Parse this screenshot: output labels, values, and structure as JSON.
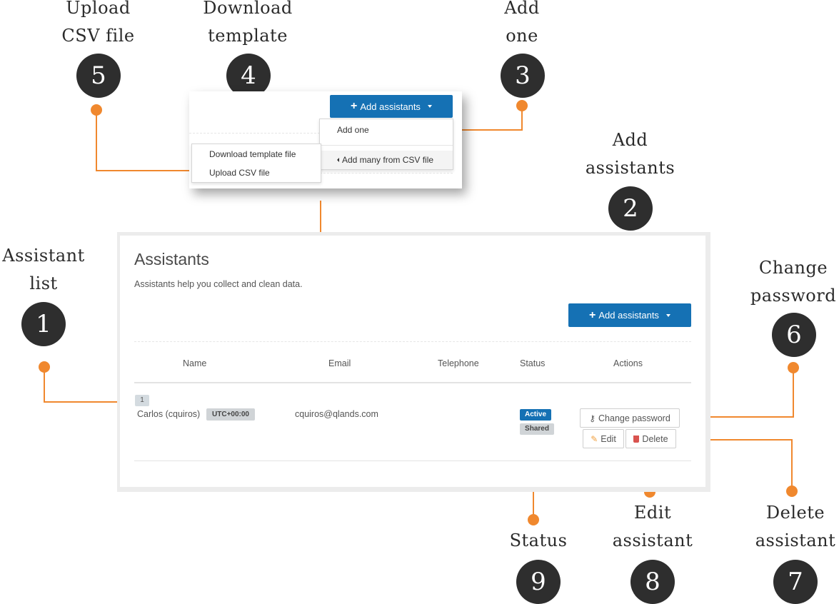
{
  "annotations": {
    "a1": {
      "line1": "Assistant",
      "line2": "list",
      "num": "1"
    },
    "a2": {
      "line1": "Add",
      "line2": "assistants",
      "num": "2"
    },
    "a3": {
      "line1": "Add",
      "line2": "one",
      "num": "3"
    },
    "a4": {
      "line1": "Download",
      "line2": "template",
      "num": "4"
    },
    "a5": {
      "line1": "Upload",
      "line2": "CSV file",
      "num": "5"
    },
    "a6": {
      "line1": "Change",
      "line2": "password",
      "num": "6"
    },
    "a7": {
      "line1": "Delete",
      "line2": "assistant",
      "num": "7"
    },
    "a8": {
      "line1": "Edit",
      "line2": "assistant",
      "num": "8"
    },
    "a9": {
      "line1": "Status",
      "num": "9"
    }
  },
  "popup": {
    "add_button_label": "Add assistants",
    "menu_add_one": "Add one",
    "menu_add_many": "Add many from CSV file",
    "submenu_download": "Download template file",
    "submenu_upload": "Upload CSV file"
  },
  "page": {
    "title": "Assistants",
    "subtitle": "Assistants help you collect and clean data.",
    "add_button_label": "Add assistants"
  },
  "table": {
    "headers": {
      "name": "Name",
      "email": "Email",
      "telephone": "Telephone",
      "status": "Status",
      "actions": "Actions"
    },
    "rows": [
      {
        "index": "1",
        "name": "Carlos (cquiros)",
        "timezone": "UTC+00:00",
        "email": "cquiros@qlands.com",
        "telephone": "",
        "status_active": "Active",
        "status_shared": "Shared",
        "change_password_label": "Change password",
        "edit_label": "Edit",
        "delete_label": "Delete"
      }
    ]
  },
  "colors": {
    "accent": "#f0882e",
    "primary": "#1571b4",
    "dark_circle": "#2e2e2e",
    "danger": "#d9534f"
  }
}
